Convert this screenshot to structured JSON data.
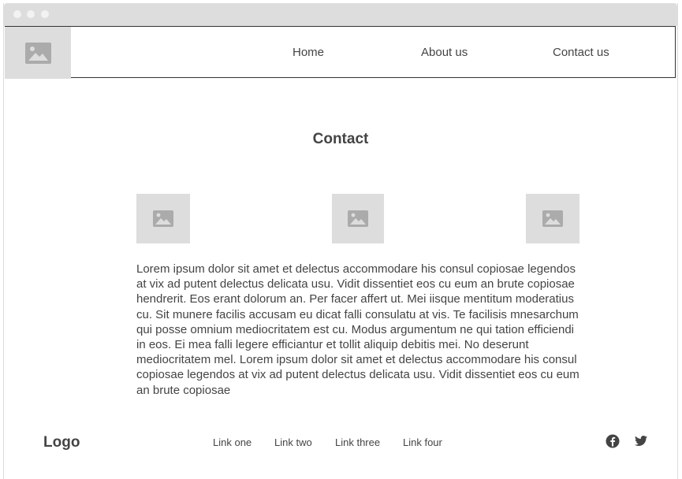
{
  "nav": {
    "items": [
      {
        "label": "Home"
      },
      {
        "label": "About us"
      },
      {
        "label": "Contact us"
      }
    ]
  },
  "main": {
    "title": "Contact",
    "body": "Lorem ipsum dolor sit amet et delectus accommodare his consul copiosae legendos at vix ad putent delectus delicata usu. Vidit dissentiet eos cu eum an brute copiosae hendrerit. Eos erant dolorum an. Per facer affert ut. Mei iisque mentitum moderatius cu. Sit munere facilis accusam eu dicat falli consulatu at vis. Te facilisis mnesarchum qui posse omnium mediocritatem est cu. Modus argumentum ne qui tation efficiendi in eos. Ei mea falli legere efficiantur et tollit aliquip debitis mei. No deserunt mediocritatem mel. Lorem ipsum dolor sit amet et delectus accommodare his consul copiosae legendos at vix ad putent delectus delicata usu. Vidit dissentiet eos cu eum an brute copiosae"
  },
  "footer": {
    "logo": "Logo",
    "links": [
      {
        "label": "Link one"
      },
      {
        "label": "Link two"
      },
      {
        "label": "Link three"
      },
      {
        "label": "Link four"
      }
    ],
    "social": [
      "facebook-icon",
      "twitter-icon"
    ]
  },
  "colors": {
    "placeholder": "#dddddd",
    "placeholder_icon": "#ababab",
    "text": "#444444",
    "titlebar": "#dddddd"
  }
}
